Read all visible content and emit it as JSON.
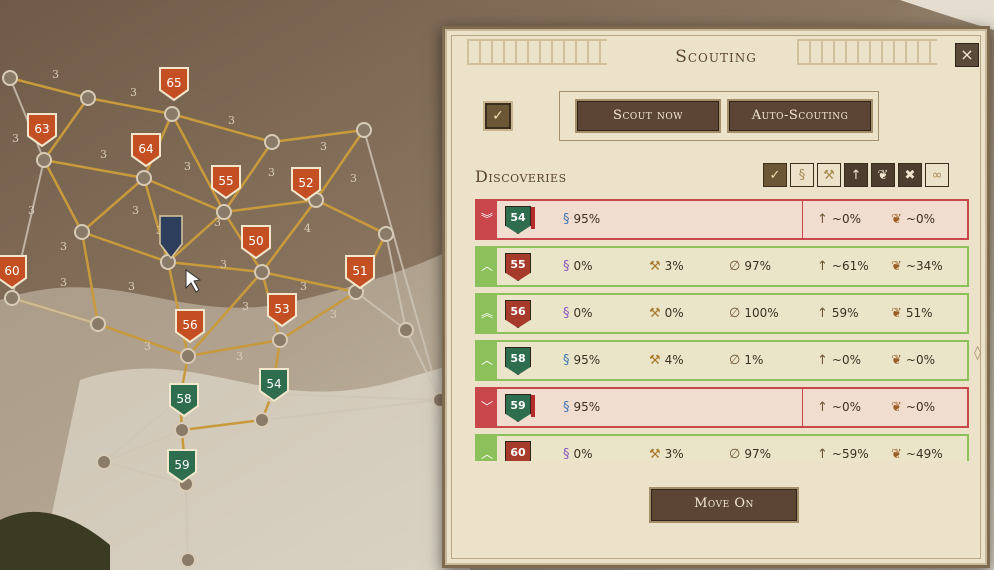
{
  "map": {
    "nodes": [
      {
        "label": "65",
        "color": "red"
      },
      {
        "label": "63",
        "color": "red"
      },
      {
        "label": "64",
        "color": "red"
      },
      {
        "label": "55",
        "color": "red"
      },
      {
        "label": "52",
        "color": "red"
      },
      {
        "label": "50",
        "color": "red"
      },
      {
        "label": "51",
        "color": "red"
      },
      {
        "label": "60",
        "color": "red"
      },
      {
        "label": "56",
        "color": "red"
      },
      {
        "label": "53",
        "color": "red"
      },
      {
        "label": "58",
        "color": "green"
      },
      {
        "label": "54",
        "color": "green"
      },
      {
        "label": "59",
        "color": "green"
      }
    ],
    "edge_weight": "3",
    "small_numbers": [
      "3",
      "3",
      "3",
      "3",
      "3",
      "3",
      "3",
      "3",
      "3",
      "3",
      "3",
      "3",
      "4",
      "3",
      "3",
      "3",
      "3",
      "3",
      "3",
      "3",
      "3",
      "3",
      "3",
      "2"
    ]
  },
  "panel": {
    "title": "Scouting",
    "close_label": "×",
    "auto_check": "✓",
    "scout_now": "Scout now",
    "auto_scouting": "Auto-Scouting",
    "discoveries_title": "Discoveries",
    "move_on": "Move On"
  },
  "filters": [
    {
      "icon": "check-icon",
      "glyph": "✓",
      "active": true
    },
    {
      "icon": "scroll-icon",
      "glyph": "§",
      "active": false
    },
    {
      "icon": "axe-icon",
      "glyph": "⚒",
      "active": false
    },
    {
      "icon": "arrow-icon",
      "glyph": "↑",
      "active": true
    },
    {
      "icon": "resource-icon",
      "glyph": "❦",
      "active": true
    },
    {
      "icon": "crossed-shield-icon",
      "glyph": "✖",
      "active": true
    },
    {
      "icon": "infinity-icon",
      "glyph": "∞",
      "active": false
    }
  ],
  "discoveries": [
    {
      "status": "bad",
      "chevron": "︾",
      "level": "54",
      "shield": "green",
      "flag": true,
      "scroll_icon": "blue",
      "scroll": "95%",
      "axe": "",
      "null": "",
      "arrow": "~0%",
      "res": "~0%"
    },
    {
      "status": "good",
      "chevron": "︿",
      "level": "55",
      "shield": "red",
      "flag": false,
      "scroll_icon": "purple",
      "scroll": "0%",
      "axe": "3%",
      "null": "97%",
      "arrow": "~61%",
      "res": "~34%"
    },
    {
      "status": "good",
      "chevron": "︽",
      "level": "56",
      "shield": "red",
      "flag": false,
      "scroll_icon": "purple",
      "scroll": "0%",
      "axe": "0%",
      "null": "100%",
      "arrow": "59%",
      "res": "51%"
    },
    {
      "status": "good",
      "chevron": "︿",
      "level": "58",
      "shield": "green",
      "flag": false,
      "scroll_icon": "blue",
      "scroll": "95%",
      "axe": "4%",
      "null": "1%",
      "arrow": "~0%",
      "res": "~0%"
    },
    {
      "status": "bad",
      "chevron": "﹀",
      "level": "59",
      "shield": "green",
      "flag": true,
      "scroll_icon": "blue",
      "scroll": "95%",
      "axe": "",
      "null": "",
      "arrow": "~0%",
      "res": "~0%"
    },
    {
      "status": "good",
      "chevron": "︿",
      "level": "60",
      "shield": "red",
      "flag": false,
      "scroll_icon": "purple",
      "scroll": "0%",
      "axe": "3%",
      "null": "97%",
      "arrow": "~59%",
      "res": "~49%"
    }
  ]
}
